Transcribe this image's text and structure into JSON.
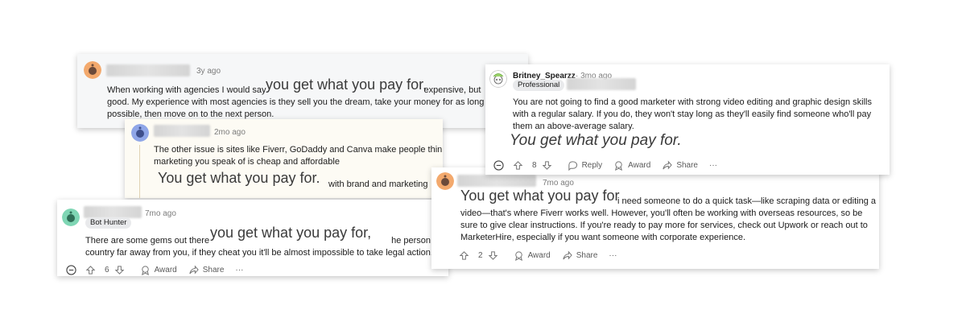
{
  "phrase": "You get what you pay for",
  "cards": {
    "c1": {
      "timestamp": "3y ago",
      "lines": [
        "When working with agencies I would say",
        "good. My experience with most agencies is they sell you the dream, take your money for as long as",
        "possible, then move on to the next person."
      ],
      "line1_tail": "expensive, but",
      "highlight": "you get what you pay for."
    },
    "c2": {
      "timestamp": "2mo ago",
      "lines": [
        "The other issue is sites like Fiverr, GoDaddy and Canva make people think that the quality",
        "marketing you speak of is cheap and affordable"
      ],
      "highlight": "You get what you pay for.",
      "highlight_tail": "with brand and marketing"
    },
    "c3": {
      "timestamp": "7mo ago",
      "flair": "Bot Hunter",
      "lines": [
        "There are some gems out there",
        "country far away from you, if they cheat you it'll be almost impossible to take legal action."
      ],
      "line1_tail": "he person is",
      "highlight": "you get what you pay for,",
      "votes": "6",
      "award": "Award",
      "share": "Share",
      "more": "···"
    },
    "c4": {
      "username": "Britney_Spearzz",
      "timestamp": "3mo ago",
      "flair": "Professional",
      "lines": [
        "You are not going to find a good marketer with strong video editing and graphic design skills",
        "with a regular salary. If you do, they won't stay long as they'll easily find someone who'll pay",
        "them an above-average salary."
      ],
      "highlight": "You get what you pay for.",
      "votes": "8",
      "reply": "Reply",
      "award": "Award",
      "share": "Share",
      "more": "···"
    },
    "c5": {
      "timestamp": "7mo ago",
      "highlight": "You get what you pay for",
      "line1_tail": "i need someone to do a quick task—like scraping data or editing a",
      "lines": [
        "video—that's where Fiverr works well. However, you'll often be working with overseas resources, so be",
        "sure to give clear instructions. If you're ready to pay more for services, check out Upwork or reach out to",
        "MarketerHire, especially if you want someone with corporate experience."
      ],
      "votes": "2",
      "award": "Award",
      "share": "Share",
      "more": "···"
    }
  },
  "colors": {
    "avatar_orange": "#f3a96d",
    "avatar_blue": "#8fa6e8",
    "avatar_green": "#7fd6b4",
    "thread_line": "#e0d2b4"
  }
}
